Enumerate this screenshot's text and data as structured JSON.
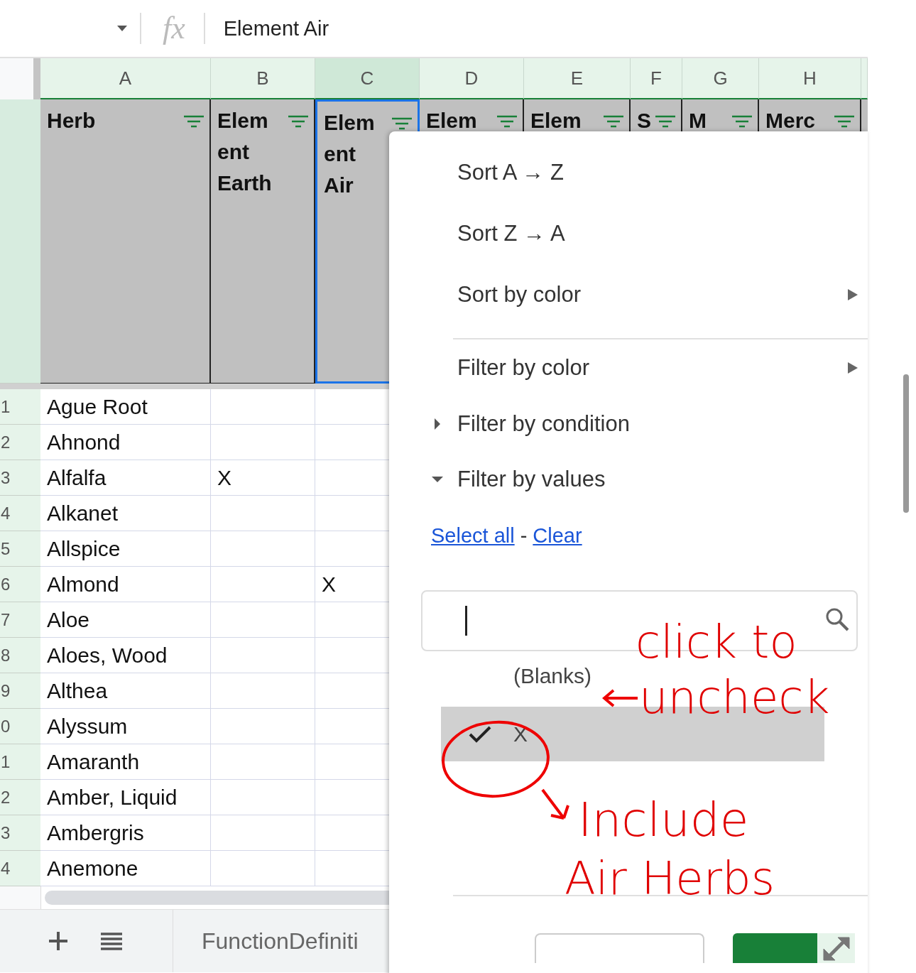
{
  "formula_bar": {
    "fx_label": "fx",
    "value": "Element Air"
  },
  "columns": [
    {
      "letter": "A",
      "selected": false
    },
    {
      "letter": "B",
      "selected": false
    },
    {
      "letter": "C",
      "selected": true
    },
    {
      "letter": "D",
      "selected": false
    },
    {
      "letter": "E",
      "selected": false
    },
    {
      "letter": "F",
      "selected": false
    },
    {
      "letter": "G",
      "selected": false
    },
    {
      "letter": "H",
      "selected": false
    }
  ],
  "header_cells": [
    {
      "lines": [
        "Herb"
      ],
      "selected": false
    },
    {
      "lines": [
        "Elem",
        "ent",
        "Earth"
      ],
      "selected": false
    },
    {
      "lines": [
        "Elem",
        "ent",
        "Air"
      ],
      "selected": true
    },
    {
      "lines": [
        "Elem"
      ],
      "selected": false
    },
    {
      "lines": [
        "Elem"
      ],
      "selected": false
    },
    {
      "lines": [
        "S"
      ],
      "selected": false
    },
    {
      "lines": [
        "M"
      ],
      "selected": false
    },
    {
      "lines": [
        "Merc"
      ],
      "selected": false
    }
  ],
  "rows": [
    {
      "number": "1",
      "herb": "Ague Root"
    },
    {
      "number": "2",
      "herb": "Ahnond"
    },
    {
      "number": "3",
      "herb": "Alfalfa",
      "column_b": "X"
    },
    {
      "number": "4",
      "herb": "Alkanet"
    },
    {
      "number": "5",
      "herb": "Allspice"
    },
    {
      "number": "6",
      "herb": "Almond",
      "column_c": "X"
    },
    {
      "number": "7",
      "herb": "Aloe"
    },
    {
      "number": "8",
      "herb": "Aloes, Wood"
    },
    {
      "number": "9",
      "herb": "Althea"
    },
    {
      "number": "0",
      "herb": "Alyssum"
    },
    {
      "number": "1",
      "herb": "Amaranth"
    },
    {
      "number": "2",
      "herb": "Amber, Liquid"
    },
    {
      "number": "3",
      "herb": "Ambergris"
    },
    {
      "number": "4",
      "herb": "Anemone"
    }
  ],
  "sheet_tab": "FunctionDefiniti",
  "filter_menu": {
    "items": [
      {
        "kind": "plain",
        "label": "Sort A → Z"
      },
      {
        "kind": "plain",
        "label": "Sort Z → A"
      },
      {
        "kind": "submenu",
        "label": "Sort by color"
      },
      {
        "kind": "divider"
      },
      {
        "kind": "submenu",
        "label": "Filter by color"
      },
      {
        "kind": "section",
        "label": "Filter by condition",
        "expanded": false
      },
      {
        "kind": "section",
        "label": "Filter by values",
        "expanded": true
      }
    ],
    "links": [
      "Select all",
      "Clear"
    ],
    "link_separator": "-",
    "values": [
      {
        "label": "(Blanks)",
        "checked": false,
        "selected": false
      },
      {
        "label": "X",
        "checked": true,
        "selected": true
      }
    ]
  },
  "annotations": [
    "click to",
    "uncheck",
    "Include",
    "Air Herbs"
  ]
}
